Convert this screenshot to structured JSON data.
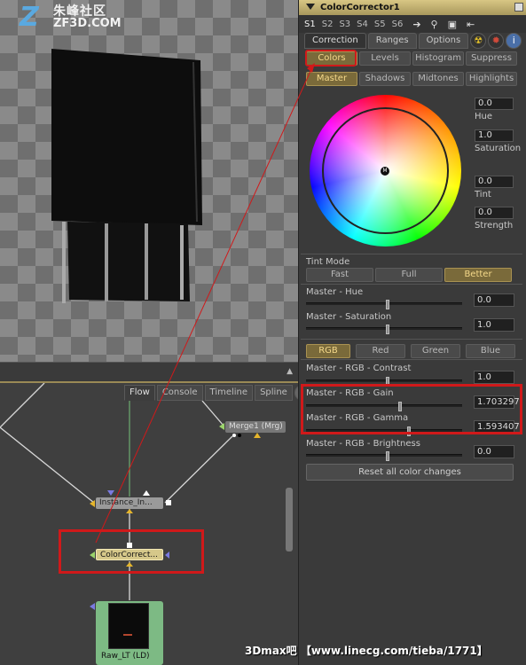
{
  "watermark": {
    "logo_mark": "Z",
    "logo_cn": "朱峰社区",
    "logo_en": "ZF3D.COM",
    "bottom": "3Dmax吧 【www.linecg.com/tieba/1771】"
  },
  "flow": {
    "tabs": [
      "Flow",
      "Console",
      "Timeline",
      "Spline"
    ],
    "info_icon": "info-icon",
    "nodes": {
      "instance": "Instance_In...",
      "merge": "Merge1 (Mrg)",
      "color_corrector": "ColorCorrect...",
      "raw": "Raw_LT (LD)"
    }
  },
  "panel": {
    "title": "ColorCorrector1",
    "slots": [
      "S1",
      "S2",
      "S3",
      "S4",
      "S5",
      "S6"
    ],
    "main_tabs": [
      "Correction",
      "Ranges",
      "Options"
    ],
    "sub_tabs": [
      "Colors",
      "Levels",
      "Histogram",
      "Suppress"
    ],
    "range_tabs": [
      "Master",
      "Shadows",
      "Midtones",
      "Highlights"
    ],
    "wheel_center_label": "M",
    "hue": {
      "label": "Hue",
      "value": "0.0"
    },
    "saturation": {
      "label": "Saturation",
      "value": "1.0"
    },
    "tint": {
      "label": "Tint",
      "value": "0.0"
    },
    "strength": {
      "label": "Strength",
      "value": "0.0"
    },
    "tint_mode": {
      "label": "Tint Mode",
      "options": [
        "Fast",
        "Full",
        "Better"
      ],
      "selected": "Better"
    },
    "master_hue": {
      "label": "Master - Hue",
      "value": "0.0"
    },
    "master_saturation": {
      "label": "Master - Saturation",
      "value": "1.0"
    },
    "channel_tabs": [
      "RGB",
      "Red",
      "Green",
      "Blue"
    ],
    "contrast": {
      "label": "Master - RGB - Contrast",
      "value": "1.0"
    },
    "gain": {
      "label": "Master - RGB - Gain",
      "value": "1.703297"
    },
    "gamma": {
      "label": "Master - RGB - Gamma",
      "value": "1.593407"
    },
    "brightness": {
      "label": "Master - RGB - Brightness",
      "value": "0.0"
    },
    "reset_label": "Reset all color changes"
  },
  "colors": {
    "accent": "#d6c88a",
    "highlight_red": "#d0191a",
    "active_button": "#7a6a3a"
  }
}
